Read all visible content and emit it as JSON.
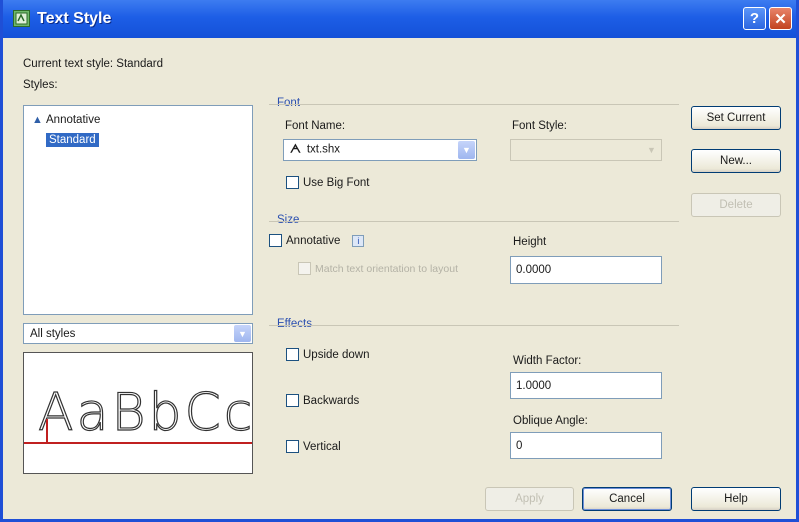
{
  "title": "Text Style",
  "title_buttons": {
    "help": "?",
    "close": "✕"
  },
  "current_style_label": "Current text style:  Standard",
  "styles_label": "Styles:",
  "styles": [
    {
      "name": "Annotative",
      "icon": "annotative-triangle-icon"
    },
    {
      "name": "Standard",
      "selected": true
    }
  ],
  "filter": {
    "value": "All styles"
  },
  "preview_text": "AaBbCc",
  "font": {
    "group": "Font",
    "name_label": "Font Name:",
    "name_value": "txt.shx",
    "style_label": "Font Style:",
    "style_value": "",
    "big_font": "Use Big Font"
  },
  "size": {
    "group": "Size",
    "annotative": "Annotative",
    "info": "i",
    "match_orientation": "Match text orientation to layout",
    "height_label": "Height",
    "height_value": "0.0000"
  },
  "effects": {
    "group": "Effects",
    "upside_down": "Upside down",
    "backwards": "Backwards",
    "vertical": "Vertical",
    "width_label": "Width Factor:",
    "width_value": "1.0000",
    "oblique_label": "Oblique Angle:",
    "oblique_value": "0"
  },
  "buttons": {
    "set_current": "Set Current",
    "new": "New...",
    "delete": "Delete",
    "apply": "Apply",
    "cancel": "Cancel",
    "help": "Help"
  },
  "colors": {
    "title_bar": "#1d5ee6",
    "selection": "#316ac5",
    "dialog_bg": "#ece9d8"
  }
}
